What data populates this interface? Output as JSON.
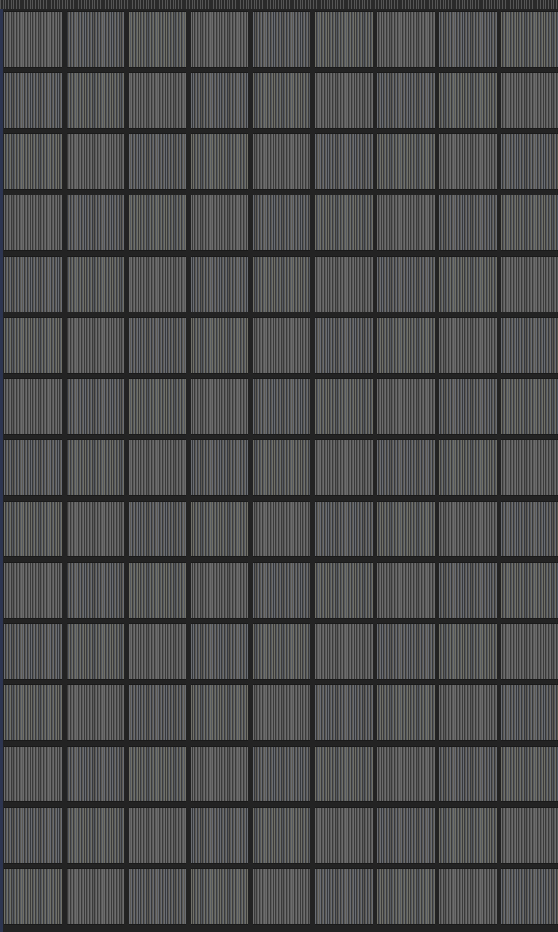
{
  "grid": {
    "columns": 9,
    "rows": 15
  },
  "colors": {
    "background": "#232323",
    "tile_base": "#4a4a4a",
    "tile_stripe_light": "#6d6d6d",
    "tile_stripe_dark": "#3a3a3a",
    "edge_tint": "#2d3550"
  }
}
